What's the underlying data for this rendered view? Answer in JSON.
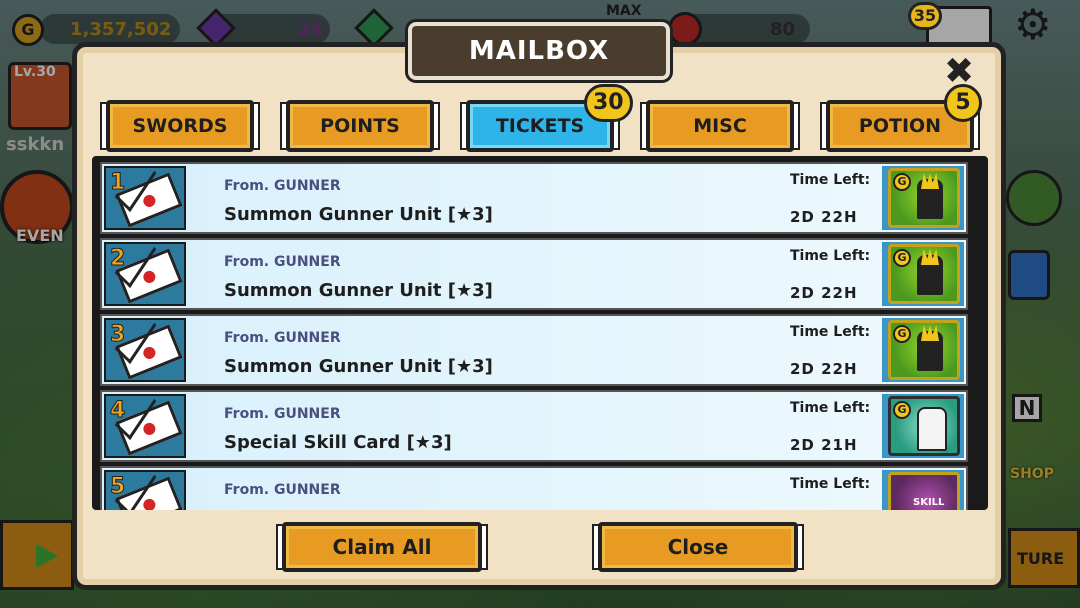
{
  "hud": {
    "gold_symbol": "G",
    "gold": "1,357,502",
    "purple_gems": "24",
    "max_label": "MAX",
    "energy": "80",
    "mail_count": "35"
  },
  "player": {
    "level": "Lv.30",
    "name": "sskkn",
    "event_label": "EVEN"
  },
  "side": {
    "shop_label": "SHOP",
    "n_label": "N",
    "adventure_label": "TURE"
  },
  "modal": {
    "title": "MAILBOX",
    "close_badge": "5"
  },
  "tabs": [
    {
      "label": "SWORDS",
      "active": false
    },
    {
      "label": "POINTS",
      "active": false
    },
    {
      "label": "TICKETS",
      "active": true,
      "badge": "30"
    },
    {
      "label": "MISC",
      "active": false
    },
    {
      "label": "POTION",
      "active": false
    }
  ],
  "mail": [
    {
      "index": "1",
      "from": "From. GUNNER",
      "subject": "Summon Gunner Unit [★3]",
      "time_label": "Time Left:",
      "time": "2D 22H",
      "reward": "gunner-unit",
      "reward_badge": "G"
    },
    {
      "index": "2",
      "from": "From. GUNNER",
      "subject": "Summon Gunner Unit [★3]",
      "time_label": "Time Left:",
      "time": "2D 22H",
      "reward": "gunner-unit",
      "reward_badge": "G"
    },
    {
      "index": "3",
      "from": "From. GUNNER",
      "subject": "Summon Gunner Unit [★3]",
      "time_label": "Time Left:",
      "time": "2D 22H",
      "reward": "gunner-unit",
      "reward_badge": "G"
    },
    {
      "index": "4",
      "from": "From. GUNNER",
      "subject": "Special Skill Card [★3]",
      "time_label": "Time Left:",
      "time": "2D 21H",
      "reward": "skill-card",
      "reward_badge": "G"
    },
    {
      "index": "5",
      "from": "From. GUNNER",
      "subject": "",
      "time_label": "Time Left:",
      "time": "",
      "reward": "skill-potion",
      "reward_badge": "SKILL"
    }
  ],
  "buttons": {
    "claim_all": "Claim All",
    "close": "Close"
  },
  "colors": {
    "tab_orange": "#e89b22",
    "tab_active_blue": "#2fb4ea",
    "badge_yellow": "#f2c51c",
    "title_plate": "#4a3d2e",
    "modal_bg": "#f1e2c6"
  }
}
